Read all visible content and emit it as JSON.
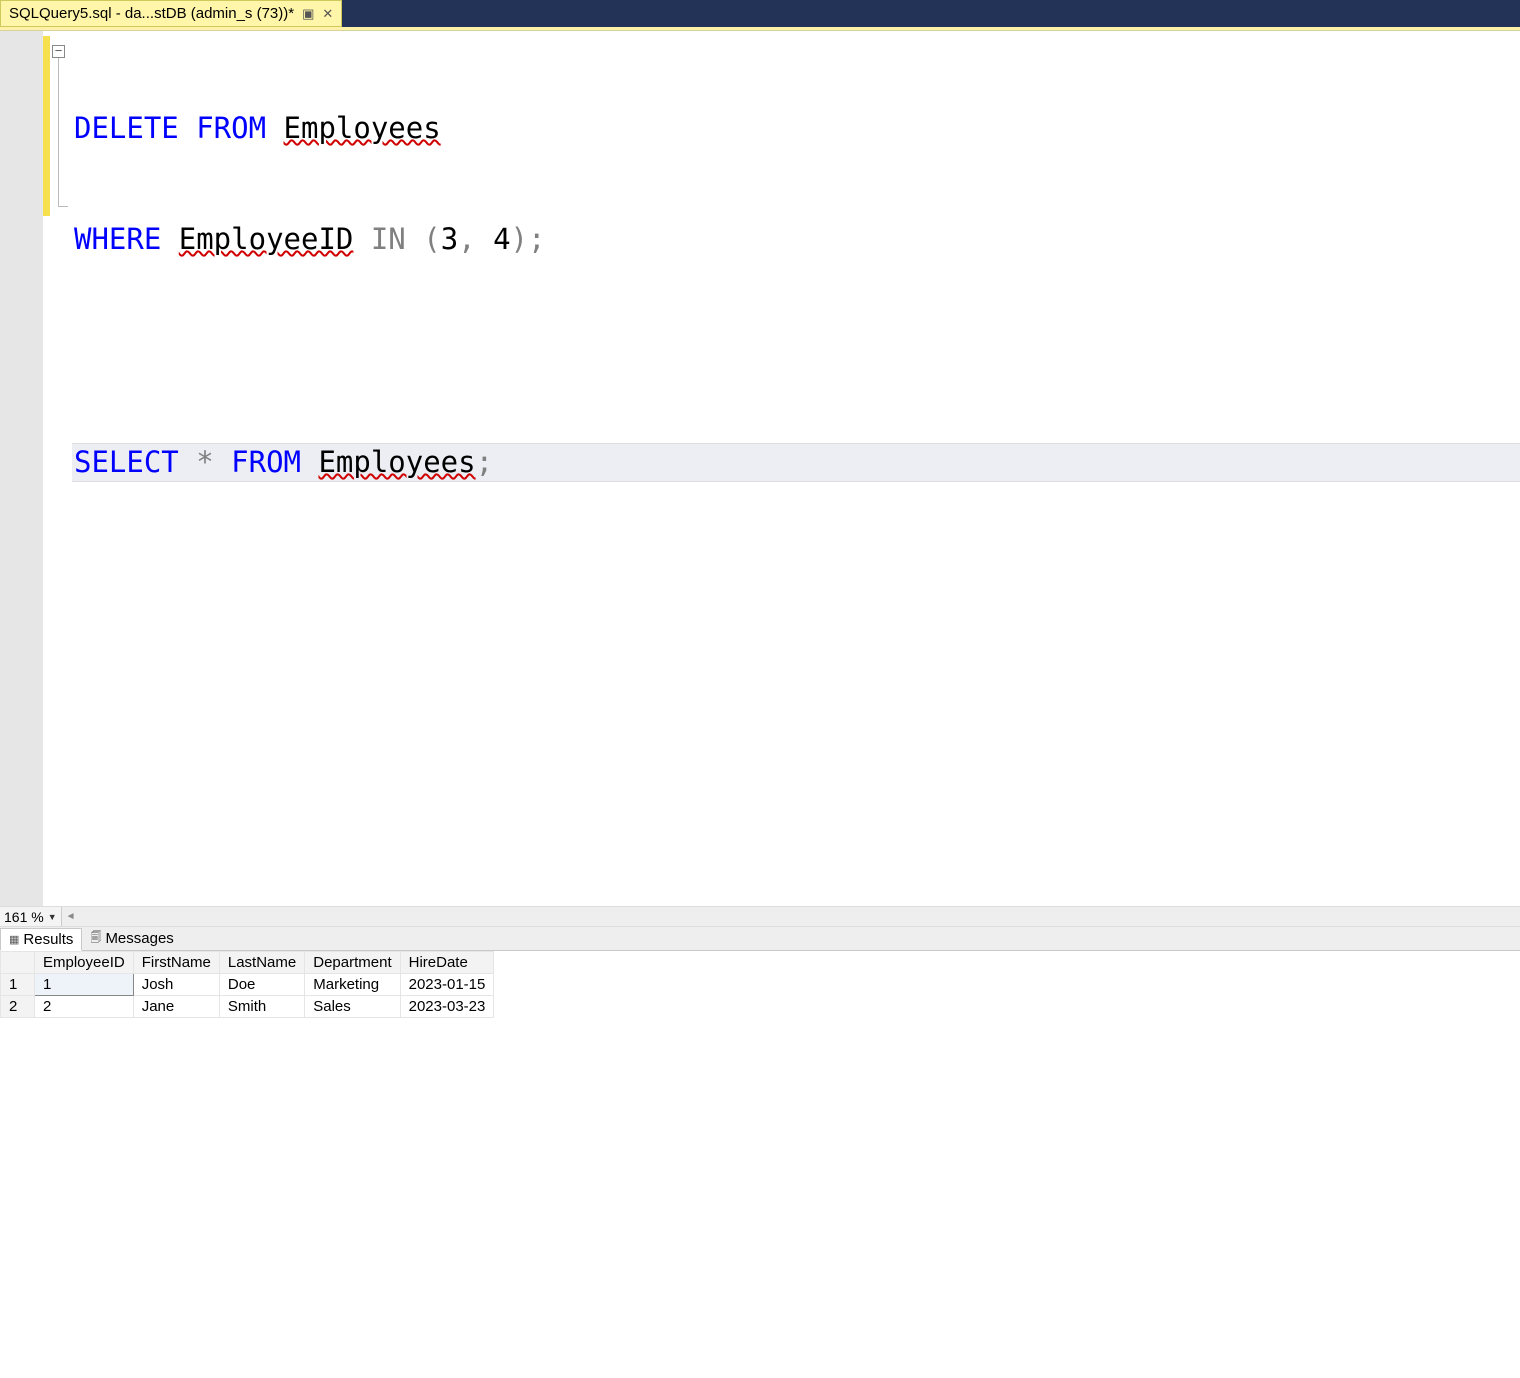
{
  "tab": {
    "title": "SQLQuery5.sql - da...stDB (admin_s (73))*"
  },
  "code": {
    "line1": {
      "t1": "DELETE",
      "t2": " FROM ",
      "t3": "Employees"
    },
    "line2": {
      "t1": "WHERE ",
      "t2": "EmployeeID",
      "t3": " IN ",
      "t4": "(",
      "t5": "3",
      "t6": ",",
      "t7": " 4",
      "t8": ");"
    },
    "line3": "",
    "line4": {
      "t1": "SELECT ",
      "t2": "*",
      "t3": " FROM ",
      "t4": "Employees",
      "t5": ";"
    }
  },
  "zoom": {
    "level": "161 %"
  },
  "resultTabs": {
    "results": "Results",
    "messages": "Messages"
  },
  "results": {
    "columns": [
      "EmployeeID",
      "FirstName",
      "LastName",
      "Department",
      "HireDate"
    ],
    "rows": [
      {
        "n": "1",
        "EmployeeID": "1",
        "FirstName": "Josh",
        "LastName": "Doe",
        "Department": "Marketing",
        "HireDate": "2023-01-15"
      },
      {
        "n": "2",
        "EmployeeID": "2",
        "FirstName": "Jane",
        "LastName": "Smith",
        "Department": "Sales",
        "HireDate": "2023-03-23"
      }
    ]
  }
}
